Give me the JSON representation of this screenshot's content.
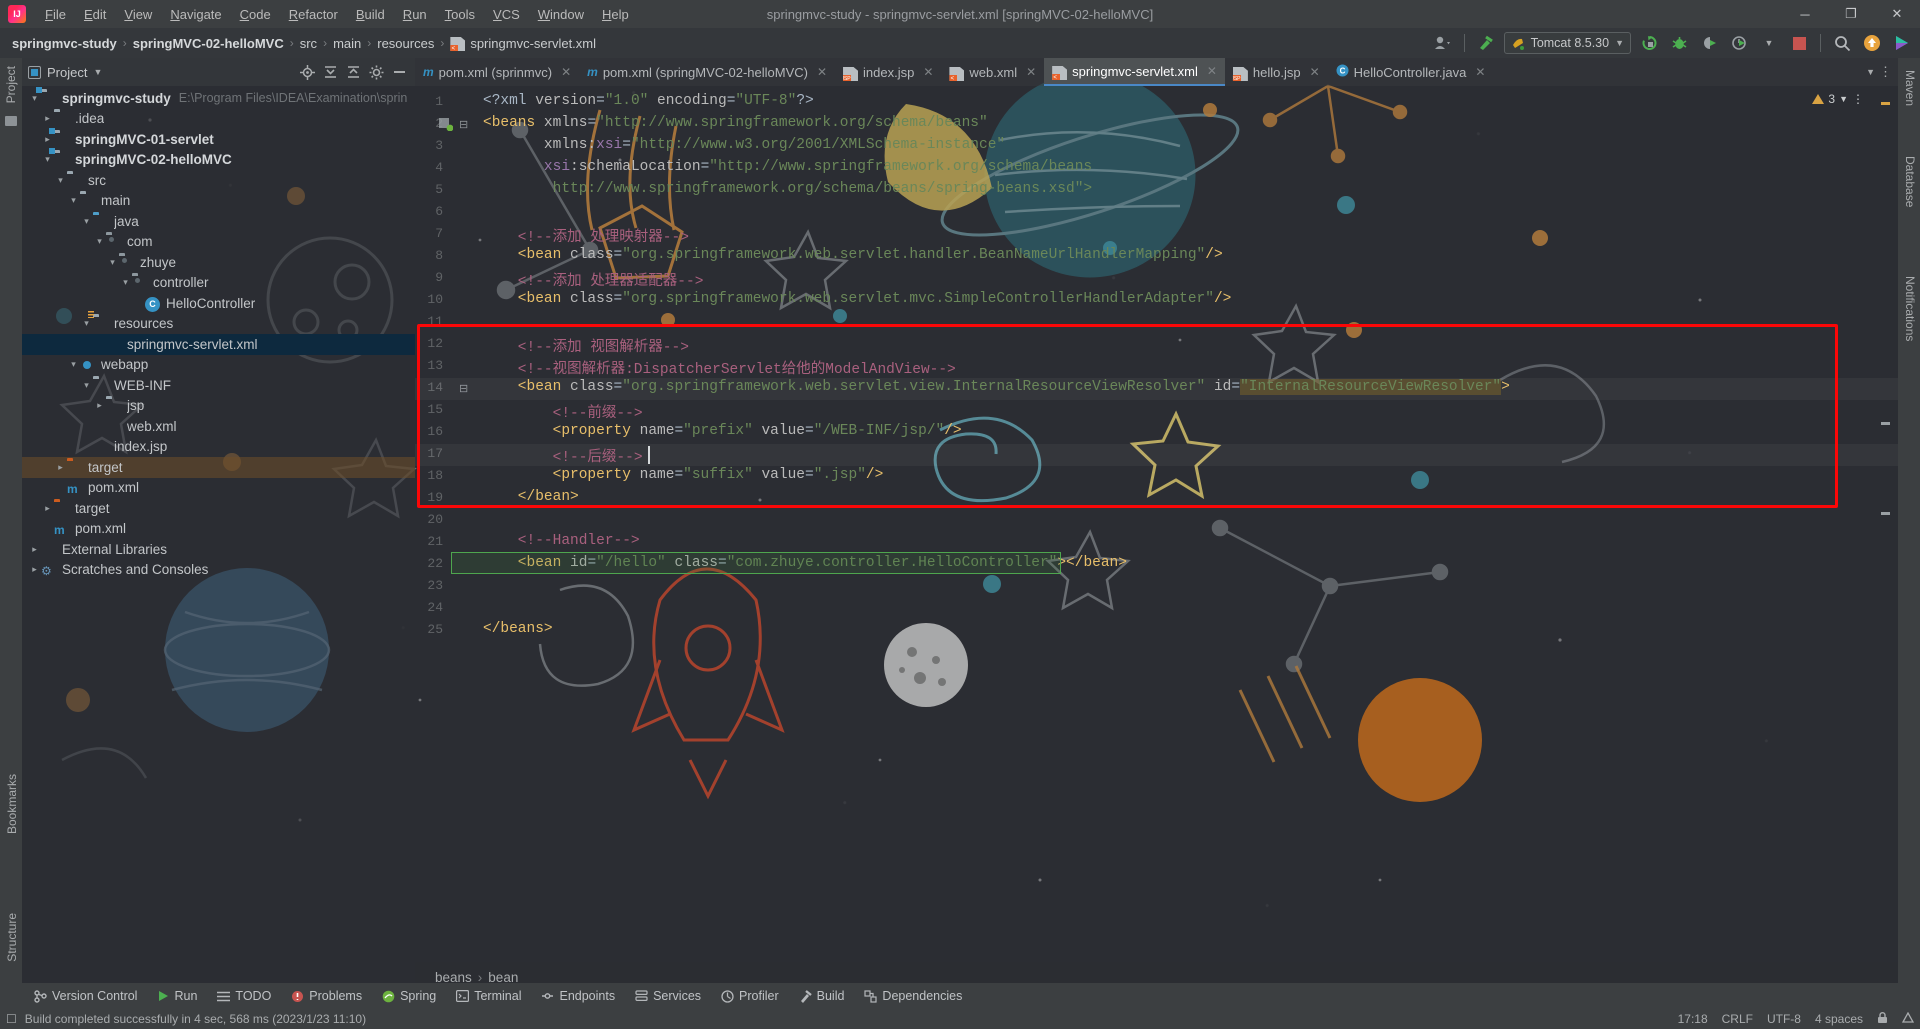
{
  "titlebar": {
    "logo": "intellij-logo",
    "menu": [
      "File",
      "Edit",
      "View",
      "Navigate",
      "Code",
      "Refactor",
      "Build",
      "Run",
      "Tools",
      "VCS",
      "Window",
      "Help"
    ],
    "window_title": "springmvc-study - springmvc-servlet.xml [springMVC-02-helloMVC]",
    "minimize": "─",
    "maximize": "❐",
    "close": "✕"
  },
  "navbar": {
    "crumbs": [
      "springmvc-study",
      "springMVC-02-helloMVC",
      "src",
      "main",
      "resources",
      "springmvc-servlet.xml"
    ],
    "separator": "›",
    "run_config": "Tomcat 8.5.30",
    "account_icon": "user-icon",
    "build_icon": "hammer-icon",
    "run_icon": "run-icon",
    "rerun_icon": "rerun-icon",
    "debug_icon": "debug-icon",
    "deploy_icon": "deploy-icon",
    "profile_icon": "profiler-icon",
    "stop_icon": "stop-icon",
    "search_icon": "search-icon",
    "update_icon": "update-icon",
    "ide_icon": "ide-icon"
  },
  "left_rail": {
    "items": [
      "Project",
      "Bookmarks",
      "Structure"
    ]
  },
  "right_rail": {
    "items": [
      "Maven",
      "Database",
      "Notifications"
    ]
  },
  "project_panel": {
    "title": "Project",
    "dropdown_icon": "chevron-down-icon",
    "tools": [
      "locate-icon",
      "expand-all-icon",
      "collapse-all-icon",
      "gear-icon",
      "minimize-icon"
    ],
    "tree": [
      {
        "label": "springmvc-study",
        "path": "E:\\Program Files\\IDEA\\Examination\\sprin",
        "indent": 0,
        "arrow": "v",
        "icon": "module-folder",
        "bold": true,
        "state": ""
      },
      {
        "label": ".idea",
        "path": "",
        "indent": 1,
        "arrow": ">",
        "icon": "folder",
        "bold": false,
        "state": ""
      },
      {
        "label": "springMVC-01-servlet",
        "path": "",
        "indent": 1,
        "arrow": ">",
        "icon": "module-folder",
        "bold": true,
        "state": ""
      },
      {
        "label": "springMVC-02-helloMVC",
        "path": "",
        "indent": 1,
        "arrow": "v",
        "icon": "module-folder",
        "bold": true,
        "state": ""
      },
      {
        "label": "src",
        "path": "",
        "indent": 2,
        "arrow": "v",
        "icon": "folder",
        "bold": false,
        "state": ""
      },
      {
        "label": "main",
        "path": "",
        "indent": 3,
        "arrow": "v",
        "icon": "folder",
        "bold": false,
        "state": ""
      },
      {
        "label": "java",
        "path": "",
        "indent": 4,
        "arrow": "v",
        "icon": "source-folder",
        "bold": false,
        "state": ""
      },
      {
        "label": "com",
        "path": "",
        "indent": 5,
        "arrow": "v",
        "icon": "package-folder",
        "bold": false,
        "state": ""
      },
      {
        "label": "zhuye",
        "path": "",
        "indent": 6,
        "arrow": "v",
        "icon": "package-folder",
        "bold": false,
        "state": ""
      },
      {
        "label": "controller",
        "path": "",
        "indent": 7,
        "arrow": "v",
        "icon": "package-folder",
        "bold": false,
        "state": ""
      },
      {
        "label": "HelloController",
        "path": "",
        "indent": 8,
        "arrow": "",
        "icon": "java-class",
        "bold": false,
        "state": ""
      },
      {
        "label": "resources",
        "path": "",
        "indent": 4,
        "arrow": "v",
        "icon": "resources-folder",
        "bold": false,
        "state": ""
      },
      {
        "label": "springmvc-servlet.xml",
        "path": "",
        "indent": 5,
        "arrow": "",
        "icon": "spring-xml",
        "bold": false,
        "state": "selected"
      },
      {
        "label": "webapp",
        "path": "",
        "indent": 3,
        "arrow": "v",
        "icon": "webapp-folder",
        "bold": false,
        "state": ""
      },
      {
        "label": "WEB-INF",
        "path": "",
        "indent": 4,
        "arrow": "v",
        "icon": "folder",
        "bold": false,
        "state": ""
      },
      {
        "label": "jsp",
        "path": "",
        "indent": 5,
        "arrow": ">",
        "icon": "folder",
        "bold": false,
        "state": ""
      },
      {
        "label": "web.xml",
        "path": "",
        "indent": 5,
        "arrow": "",
        "icon": "web-xml",
        "bold": false,
        "state": ""
      },
      {
        "label": "index.jsp",
        "path": "",
        "indent": 4,
        "arrow": "",
        "icon": "jsp-file",
        "bold": false,
        "state": ""
      },
      {
        "label": "target",
        "path": "",
        "indent": 2,
        "arrow": ">",
        "icon": "target-folder",
        "bold": false,
        "state": "highlight"
      },
      {
        "label": "pom.xml",
        "path": "",
        "indent": 2,
        "arrow": "",
        "icon": "maven-file",
        "bold": false,
        "state": ""
      },
      {
        "label": "target",
        "path": "",
        "indent": 1,
        "arrow": ">",
        "icon": "target-folder",
        "bold": false,
        "state": ""
      },
      {
        "label": "pom.xml",
        "path": "",
        "indent": 1,
        "arrow": "",
        "icon": "maven-file",
        "bold": false,
        "state": ""
      },
      {
        "label": "External Libraries",
        "path": "",
        "indent": 0,
        "arrow": ">",
        "icon": "libraries",
        "bold": false,
        "state": ""
      },
      {
        "label": "Scratches and Consoles",
        "path": "",
        "indent": 0,
        "arrow": ">",
        "icon": "scratches",
        "bold": false,
        "state": ""
      }
    ]
  },
  "editor": {
    "tabs": [
      {
        "label": "pom.xml (sprinmvc)",
        "icon": "maven-icon",
        "active": false
      },
      {
        "label": "pom.xml (springMVC-02-helloMVC)",
        "icon": "maven-icon",
        "active": false
      },
      {
        "label": "index.jsp",
        "icon": "jsp-icon",
        "active": false
      },
      {
        "label": "web.xml",
        "icon": "xml-icon",
        "active": false
      },
      {
        "label": "springmvc-servlet.xml",
        "icon": "spring-icon",
        "active": true
      },
      {
        "label": "hello.jsp",
        "icon": "jsp-icon",
        "active": false
      },
      {
        "label": "HelloController.java",
        "icon": "java-icon",
        "active": false
      }
    ],
    "tab_close": "✕",
    "tabs_overflow_icon": "chevron-down-icon",
    "tabs_more_icon": "more-vertical-icon",
    "inspection_count": "3",
    "inspection_icon": "warning-triangle-icon",
    "breadcrumb": [
      "beans",
      "bean"
    ],
    "breadcrumb_sep": "›",
    "line_numbers": [
      "1",
      "2",
      "3",
      "4",
      "5",
      "6",
      "7",
      "8",
      "9",
      "10",
      "11",
      "12",
      "13",
      "14",
      "15",
      "16",
      "17",
      "18",
      "19",
      "20",
      "21",
      "22",
      "23",
      "24",
      "25"
    ],
    "code_lines": [
      {
        "n": 1,
        "segments": [
          {
            "t": "<?xml ",
            "c": "punct"
          },
          {
            "t": "version",
            "c": "attr"
          },
          {
            "t": "=",
            "c": "punct"
          },
          {
            "t": "\"1.0\"",
            "c": "str"
          },
          {
            "t": " encoding",
            "c": "attr"
          },
          {
            "t": "=",
            "c": "punct"
          },
          {
            "t": "\"UTF-8\"",
            "c": "str"
          },
          {
            "t": "?>",
            "c": "punct"
          }
        ]
      },
      {
        "n": 2,
        "segments": [
          {
            "t": "<beans",
            "c": "tag"
          },
          {
            "t": " xmlns",
            "c": "attr"
          },
          {
            "t": "=",
            "c": "punct"
          },
          {
            "t": "\"http://www.springframework.org/schema/beans\"",
            "c": "str"
          }
        ]
      },
      {
        "n": 3,
        "segments": [
          {
            "t": "       xmlns:",
            "c": "attr"
          },
          {
            "t": "xsi",
            "c": "ns"
          },
          {
            "t": "=",
            "c": "punct"
          },
          {
            "t": "\"http://www.w3.org/2001/XMLSchema-instance\"",
            "c": "str"
          }
        ]
      },
      {
        "n": 4,
        "segments": [
          {
            "t": "       ",
            "c": "punct"
          },
          {
            "t": "xsi",
            "c": "ns"
          },
          {
            "t": ":schemaLocation",
            "c": "attr"
          },
          {
            "t": "=",
            "c": "punct"
          },
          {
            "t": "\"http://www.springframework.org/schema/beans",
            "c": "str"
          }
        ]
      },
      {
        "n": 5,
        "segments": [
          {
            "t": "        http://www.springframework.org/schema/beans/spring-beans.xsd\">",
            "c": "str"
          }
        ]
      },
      {
        "n": 6,
        "segments": []
      },
      {
        "n": 7,
        "segments": [
          {
            "t": "    <!--添加 处理映射器-->",
            "c": "cmt2"
          }
        ]
      },
      {
        "n": 8,
        "segments": [
          {
            "t": "    <bean",
            "c": "tag"
          },
          {
            "t": " class",
            "c": "attr"
          },
          {
            "t": "=",
            "c": "punct"
          },
          {
            "t": "\"org.springframework.web.servlet.handler.BeanNameUrlHandlerMapping\"",
            "c": "str"
          },
          {
            "t": "/>",
            "c": "tag"
          }
        ]
      },
      {
        "n": 9,
        "segments": [
          {
            "t": "    <!--添加 处理器适配器-->",
            "c": "cmt2"
          }
        ]
      },
      {
        "n": 10,
        "segments": [
          {
            "t": "    <bean",
            "c": "tag"
          },
          {
            "t": " class",
            "c": "attr"
          },
          {
            "t": "=",
            "c": "punct"
          },
          {
            "t": "\"org.springframework.web.servlet.mvc.SimpleControllerHandlerAdapter\"",
            "c": "str"
          },
          {
            "t": "/>",
            "c": "tag"
          }
        ]
      },
      {
        "n": 11,
        "segments": []
      },
      {
        "n": 12,
        "segments": [
          {
            "t": "    <!--添加 视图解析器-->",
            "c": "cmt2"
          }
        ]
      },
      {
        "n": 13,
        "segments": [
          {
            "t": "    <!--视图解析器:DispatcherServlet给他的ModelAndView-->",
            "c": "cmt2"
          }
        ]
      },
      {
        "n": 14,
        "segments": [
          {
            "t": "    <bean",
            "c": "tag"
          },
          {
            "t": " class",
            "c": "attr"
          },
          {
            "t": "=",
            "c": "punct"
          },
          {
            "t": "\"org.springframework.web.servlet.view.InternalResourceViewResolver\"",
            "c": "str"
          },
          {
            "t": " id",
            "c": "attr"
          },
          {
            "t": "=",
            "c": "punct"
          },
          {
            "t": "\"InternalResourceViewResolver\"",
            "c": "hl"
          },
          {
            "t": ">",
            "c": "tag"
          }
        ]
      },
      {
        "n": 15,
        "segments": [
          {
            "t": "        <!--前缀-->",
            "c": "cmt2"
          }
        ]
      },
      {
        "n": 16,
        "segments": [
          {
            "t": "        <property",
            "c": "tag"
          },
          {
            "t": " name",
            "c": "attr"
          },
          {
            "t": "=",
            "c": "punct"
          },
          {
            "t": "\"prefix\"",
            "c": "str"
          },
          {
            "t": " value",
            "c": "attr"
          },
          {
            "t": "=",
            "c": "punct"
          },
          {
            "t": "\"/WEB-INF/jsp/\"",
            "c": "str"
          },
          {
            "t": "/>",
            "c": "tag"
          }
        ]
      },
      {
        "n": 17,
        "segments": [
          {
            "t": "        <!--后缀-->",
            "c": "cmt2"
          }
        ]
      },
      {
        "n": 18,
        "segments": [
          {
            "t": "        <property",
            "c": "tag"
          },
          {
            "t": " name",
            "c": "attr"
          },
          {
            "t": "=",
            "c": "punct"
          },
          {
            "t": "\"suffix\"",
            "c": "str"
          },
          {
            "t": " value",
            "c": "attr"
          },
          {
            "t": "=",
            "c": "punct"
          },
          {
            "t": "\".jsp\"",
            "c": "str"
          },
          {
            "t": "/>",
            "c": "tag"
          }
        ]
      },
      {
        "n": 19,
        "segments": [
          {
            "t": "    </bean>",
            "c": "tag"
          }
        ]
      },
      {
        "n": 20,
        "segments": []
      },
      {
        "n": 21,
        "segments": [
          {
            "t": "    <!--Handler-->",
            "c": "cmt2"
          }
        ]
      },
      {
        "n": 22,
        "segments": [
          {
            "t": "    <bean",
            "c": "tag"
          },
          {
            "t": " id",
            "c": "attr"
          },
          {
            "t": "=",
            "c": "punct"
          },
          {
            "t": "\"/hello\"",
            "c": "str"
          },
          {
            "t": " class",
            "c": "attr"
          },
          {
            "t": "=",
            "c": "punct"
          },
          {
            "t": "\"com.zhuye.controller.HelloController\"",
            "c": "str"
          },
          {
            "t": ">",
            "c": "tag"
          },
          {
            "t": "</bean>",
            "c": "tag"
          }
        ]
      },
      {
        "n": 23,
        "segments": []
      },
      {
        "n": 24,
        "segments": []
      },
      {
        "n": 25,
        "segments": [
          {
            "t": "</beans>",
            "c": "tag"
          }
        ]
      }
    ],
    "annotations": {
      "red_box_label": "view-resolver-highlight-box",
      "green_box_label": "handler-bean-highlight-box",
      "red_color": "#fb0707",
      "green_color": "#4ea64e"
    }
  },
  "bottom_tools": [
    {
      "label": "Version Control",
      "icon": "branch-icon"
    },
    {
      "label": "Run",
      "icon": "run-icon"
    },
    {
      "label": "TODO",
      "icon": "todo-icon"
    },
    {
      "label": "Problems",
      "icon": "problems-icon"
    },
    {
      "label": "Spring",
      "icon": "spring-icon"
    },
    {
      "label": "Terminal",
      "icon": "terminal-icon"
    },
    {
      "label": "Endpoints",
      "icon": "endpoints-icon"
    },
    {
      "label": "Services",
      "icon": "services-icon"
    },
    {
      "label": "Profiler",
      "icon": "profiler-icon"
    },
    {
      "label": "Build",
      "icon": "build-icon"
    },
    {
      "label": "Dependencies",
      "icon": "dependencies-icon"
    }
  ],
  "status_bar": {
    "message": "Build completed successfully in 4 sec, 568 ms (2023/1/23 11:10)",
    "message_icon": "info-icon",
    "position": "17:18",
    "line_separator": "CRLF",
    "encoding": "UTF-8",
    "indent": "4 spaces",
    "lock_icon": "lock-icon",
    "inspection_icon": "inspection-icon"
  }
}
